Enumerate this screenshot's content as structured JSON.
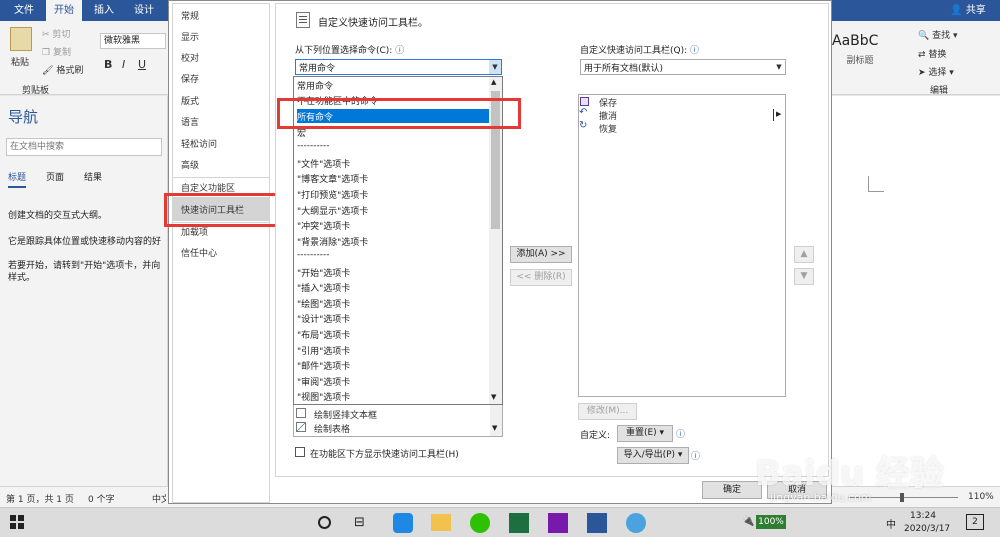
{
  "ribbon": {
    "tabs": [
      "文件",
      "开始",
      "插入",
      "设计"
    ],
    "share": "共享",
    "clipboard": {
      "paste": "粘贴",
      "cut": "剪切",
      "copy": "复制",
      "format_painter": "格式刷",
      "group": "剪贴板"
    },
    "font_name": "微软雅黑",
    "font_buttons": [
      "B",
      "I",
      "U"
    ],
    "style_preview": "AaBbC",
    "style_name": "副标题",
    "editing": {
      "find": "查找",
      "replace": "替换",
      "select": "选择",
      "group": "编辑"
    }
  },
  "nav_pane": {
    "title": "导航",
    "search_placeholder": "在文档中搜索",
    "tabs": [
      "标题",
      "页面",
      "结果"
    ],
    "text1": "创建文档的交互式大纲。",
    "text2": "它是跟踪具体位置或快速移动内容的好",
    "text3": "若要开始，请转到\"开始\"选项卡，并向",
    "text4": "样式。"
  },
  "dialog": {
    "categories": [
      "常规",
      "显示",
      "校对",
      "保存",
      "版式",
      "语言",
      "轻松访问",
      "高级",
      "自定义功能区",
      "快速访问工具栏",
      "加载项",
      "信任中心"
    ],
    "selected_category": "快速访问工具栏",
    "heading": "自定义快速访问工具栏。",
    "choose_label": "从下列位置选择命令(C):",
    "choose_value": "常用命令",
    "dropdown_items": [
      "常用命令",
      "不在功能区中的命令",
      "所有命令",
      "宏",
      "----------",
      "\"文件\"选项卡",
      "\"博客文章\"选项卡",
      "\"打印预览\"选项卡",
      "\"大纲显示\"选项卡",
      "\"冲突\"选项卡",
      "\"背景消除\"选项卡",
      "----------",
      "\"开始\"选项卡",
      "\"插入\"选项卡",
      "\"绘图\"选项卡",
      "\"设计\"选项卡",
      "\"布局\"选项卡",
      "\"引用\"选项卡",
      "\"邮件\"选项卡",
      "\"审阅\"选项卡",
      "\"视图\"选项卡"
    ],
    "highlighted_item": "所有命令",
    "below_items": [
      "绘制竖排文本框",
      "绘制表格"
    ],
    "qat_label": "自定义快速访问工具栏(Q):",
    "qat_value": "用于所有文档(默认)",
    "qat_items": [
      "保存",
      "撤消",
      "恢复"
    ],
    "add_button": "添加(A) >>",
    "remove_button": "<< 删除(R)",
    "modify_button": "修改(M)...",
    "customize_label": "自定义:",
    "reset_button": "重置(E) ▾",
    "import_export_button": "导入/导出(P) ▾",
    "checkbox_label": "在功能区下方显示快速访问工具栏(H)",
    "ok_button": "确定",
    "cancel_button": "取消"
  },
  "statusbar": {
    "page": "第 1 页，共 1 页",
    "words": "0 个字",
    "lang": "中文",
    "zoom": "110%"
  },
  "taskbar": {
    "battery": "100%",
    "ime": "中",
    "time": "13:24",
    "date": "2020/3/17",
    "notifications": "2",
    "watermark": "Baidu 经验",
    "watermark_url": "jingyan.baidu.com"
  },
  "colors": {
    "word_blue": "#2b579a",
    "highlight": "#0078d7",
    "red_box": "#e53935"
  }
}
